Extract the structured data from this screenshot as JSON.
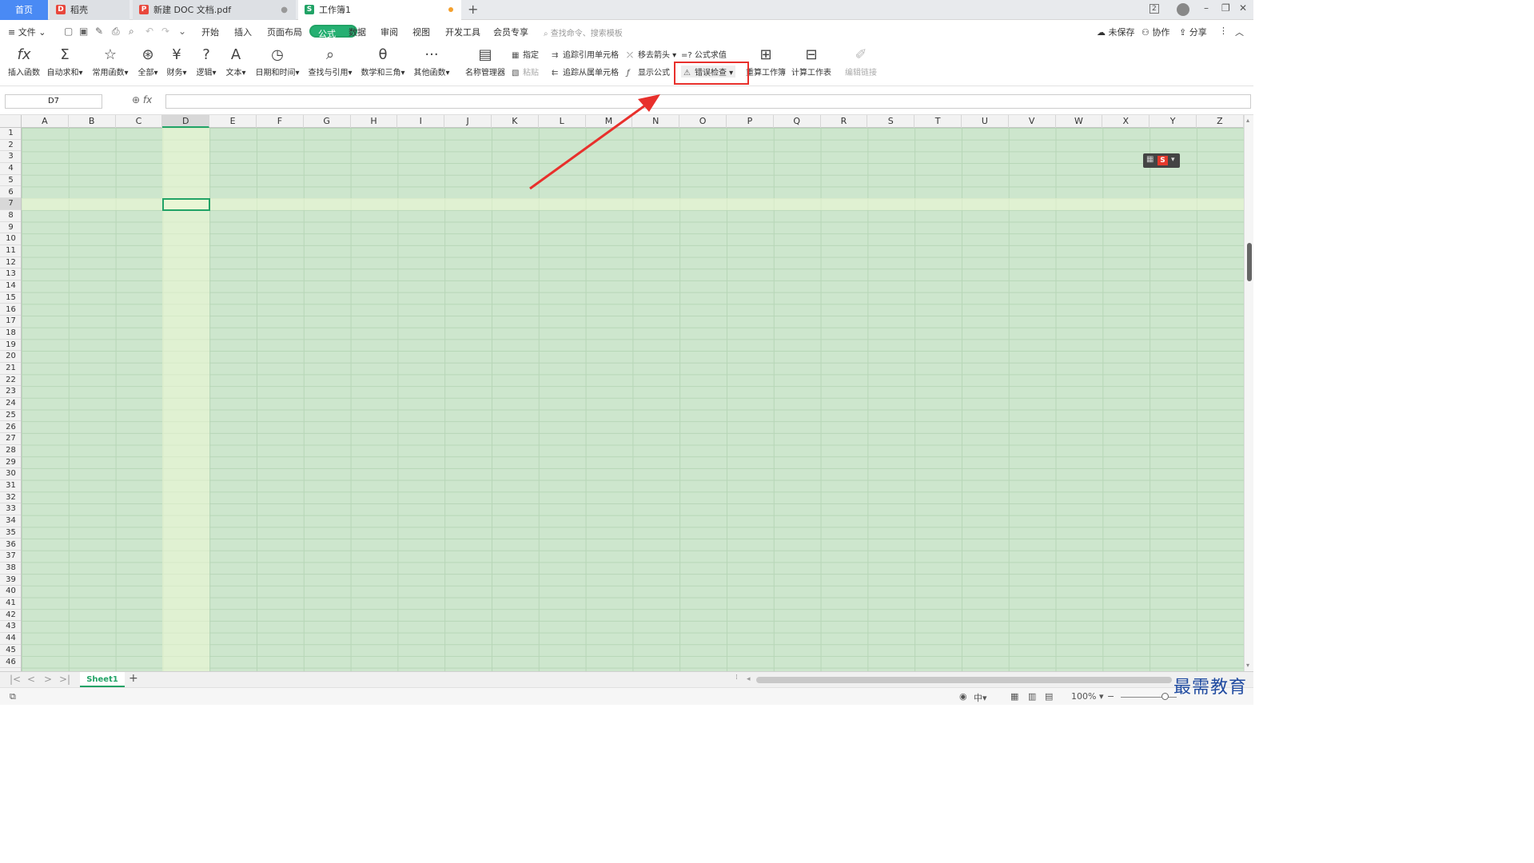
{
  "tabs": [
    {
      "label": "首页"
    },
    {
      "label": "稻壳",
      "icon": "daoke-icon"
    },
    {
      "label": "新建 DOC 文档.pdf",
      "icon": "pdf-icon"
    },
    {
      "label": "工作簿1",
      "icon": "sheet-icon",
      "unsaved": true
    }
  ],
  "window": {
    "badge": "2"
  },
  "menu": {
    "file": "文件",
    "items": [
      "开始",
      "插入",
      "页面布局",
      "公式",
      "数据",
      "审阅",
      "视图",
      "开发工具",
      "会员专享"
    ],
    "active": "公式",
    "search_placeholder": "查找命令、搜索模板",
    "unsaved": "未保存",
    "collab": "协作",
    "share": "分享"
  },
  "ribbon": {
    "big": [
      {
        "label": "插入函数",
        "icon": "fx-icon"
      },
      {
        "label": "自动求和",
        "icon": "sigma-icon",
        "dropdown": true
      },
      {
        "label": "常用函数",
        "icon": "star-icon",
        "dropdown": true
      },
      {
        "label": "全部",
        "icon": "asterisk-icon",
        "dropdown": true
      },
      {
        "label": "财务",
        "icon": "yen-icon",
        "dropdown": true
      },
      {
        "label": "逻辑",
        "icon": "question-icon",
        "dropdown": true
      },
      {
        "label": "文本",
        "icon": "text-a-icon",
        "dropdown": true
      },
      {
        "label": "日期和时间",
        "icon": "clock-icon",
        "dropdown": true
      },
      {
        "label": "查找与引用",
        "icon": "lookup-icon",
        "dropdown": true
      },
      {
        "label": "数学和三角",
        "icon": "theta-icon",
        "dropdown": true
      },
      {
        "label": "其他函数",
        "icon": "more-icon",
        "dropdown": true
      },
      {
        "label": "名称管理器",
        "icon": "name-manager-icon"
      }
    ],
    "small": {
      "assign": "指定",
      "paste": "粘贴",
      "trace_precedents": "追踪引用单元格",
      "trace_dependents": "追踪从属单元格",
      "remove_arrows": "移去箭头",
      "show_formulas": "显示公式",
      "evaluate": "=? 公式求值",
      "error_check": "错误检查"
    },
    "right": [
      {
        "label": "重算工作簿"
      },
      {
        "label": "计算工作表"
      },
      {
        "label": "编辑链接",
        "disabled": true
      }
    ]
  },
  "formula_bar": {
    "name_box": "D7",
    "fx": "fx",
    "value": ""
  },
  "grid": {
    "columns": [
      "A",
      "B",
      "C",
      "D",
      "E",
      "F",
      "G",
      "H",
      "I",
      "J",
      "K",
      "L",
      "M",
      "N",
      "O",
      "P",
      "Q",
      "R",
      "S",
      "T",
      "U",
      "V",
      "W",
      "X",
      "Y",
      "Z"
    ],
    "rows": [
      "1",
      "2",
      "3",
      "4",
      "5",
      "6",
      "7",
      "8",
      "9",
      "10",
      "11",
      "12",
      "13",
      "14",
      "15",
      "16",
      "17",
      "18",
      "19",
      "20",
      "21",
      "22",
      "23",
      "24",
      "25",
      "26",
      "27",
      "28",
      "29",
      "30",
      "31",
      "32",
      "33",
      "34",
      "35",
      "36",
      "37",
      "38",
      "39",
      "40",
      "41",
      "42",
      "43",
      "44",
      "45",
      "46"
    ],
    "selected_col": "D",
    "selected_row": "7",
    "active_cell": "D7"
  },
  "sheets": {
    "tabs": [
      "Sheet1"
    ],
    "active": "Sheet1"
  },
  "status": {
    "zoom": "100%"
  },
  "watermark": "最需教育",
  "colors": {
    "accent": "#21a366",
    "grid_bg": "#cde6cd",
    "highlight_box": "#e8302c",
    "arrow": "#e8302c"
  }
}
